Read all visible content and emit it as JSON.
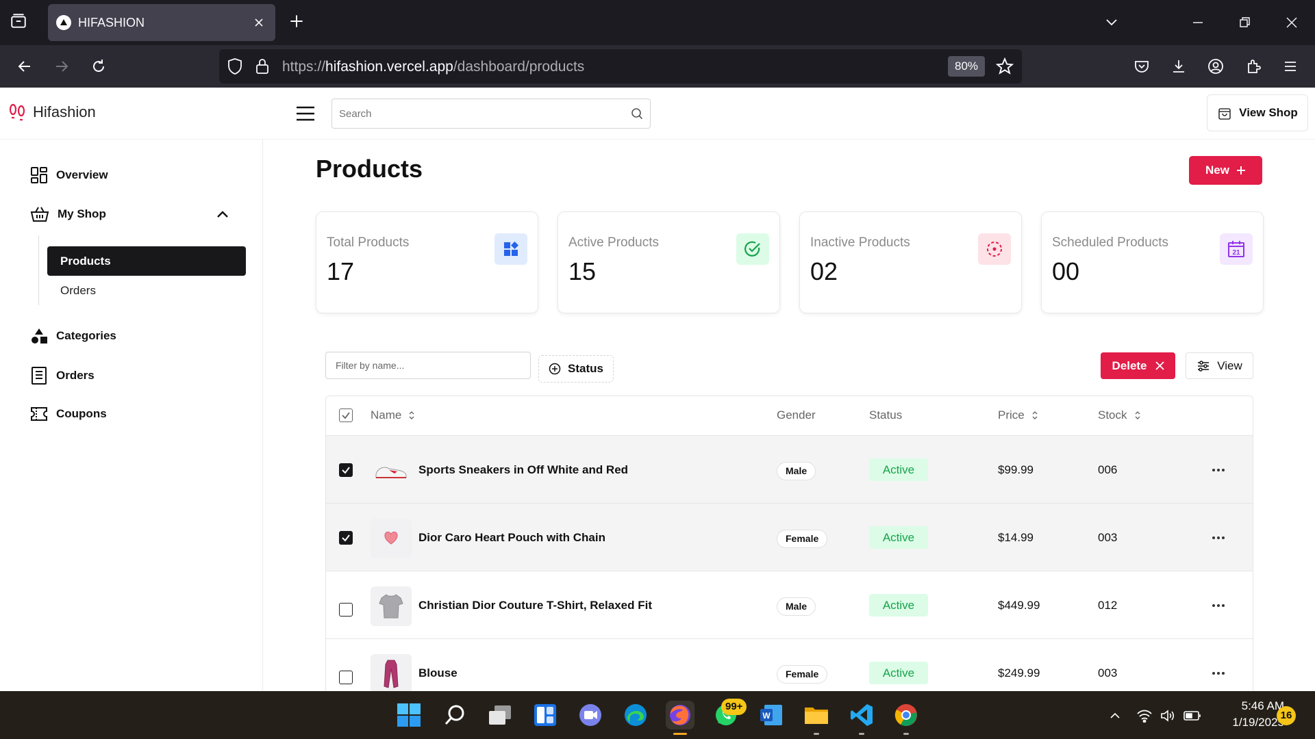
{
  "browser": {
    "tab_title": "HIFASHION",
    "url_prefix": "https://",
    "url_domain": "hifashion.vercel.app",
    "url_path": "/dashboard/products",
    "zoom": "80%"
  },
  "header": {
    "brand": "Hifashion",
    "search_placeholder": "Search",
    "view_shop_label": "View Shop"
  },
  "sidebar": {
    "overview": "Overview",
    "my_shop": "My Shop",
    "products": "Products",
    "orders_sub": "Orders",
    "categories": "Categories",
    "orders": "Orders",
    "coupons": "Coupons"
  },
  "main": {
    "title": "Products",
    "new_label": "New",
    "stats": [
      {
        "label": "Total Products",
        "value": "17",
        "icon": "grid-icon",
        "color": "#2563eb"
      },
      {
        "label": "Active Products",
        "value": "15",
        "icon": "check-circle-icon",
        "color": "#16a34a"
      },
      {
        "label": "Inactive Products",
        "value": "02",
        "icon": "dashed-circle-icon",
        "color": "#e11d48"
      },
      {
        "label": "Scheduled Products",
        "value": "00",
        "icon": "calendar-icon",
        "color": "#9333ea"
      }
    ],
    "filter_placeholder": "Filter by name...",
    "status_filter_label": "Status",
    "delete_label": "Delete",
    "view_label": "View",
    "columns": {
      "name": "Name",
      "gender": "Gender",
      "status": "Status",
      "price": "Price",
      "stock": "Stock"
    },
    "rows": [
      {
        "name": "Sports Sneakers in Off White and Red",
        "gender": "Male",
        "status": "Active",
        "price": "$99.99",
        "stock": "006",
        "checked": true
      },
      {
        "name": "Dior Caro Heart Pouch with Chain",
        "gender": "Female",
        "status": "Active",
        "price": "$14.99",
        "stock": "003",
        "checked": true
      },
      {
        "name": "Christian Dior Couture T-Shirt, Relaxed Fit",
        "gender": "Male",
        "status": "Active",
        "price": "$449.99",
        "stock": "012",
        "checked": false
      },
      {
        "name": "Blouse",
        "gender": "Female",
        "status": "Active",
        "price": "$249.99",
        "stock": "003",
        "checked": false
      }
    ]
  },
  "taskbar": {
    "whatsapp_badge": "99+",
    "time": "5:46 AM",
    "date": "1/19/2025",
    "notifications": "16"
  },
  "colors": {
    "accent": "#e11d48",
    "active_bg": "#dcfce7",
    "active_text": "#16a34a",
    "sidebar_active": "#18181b"
  }
}
